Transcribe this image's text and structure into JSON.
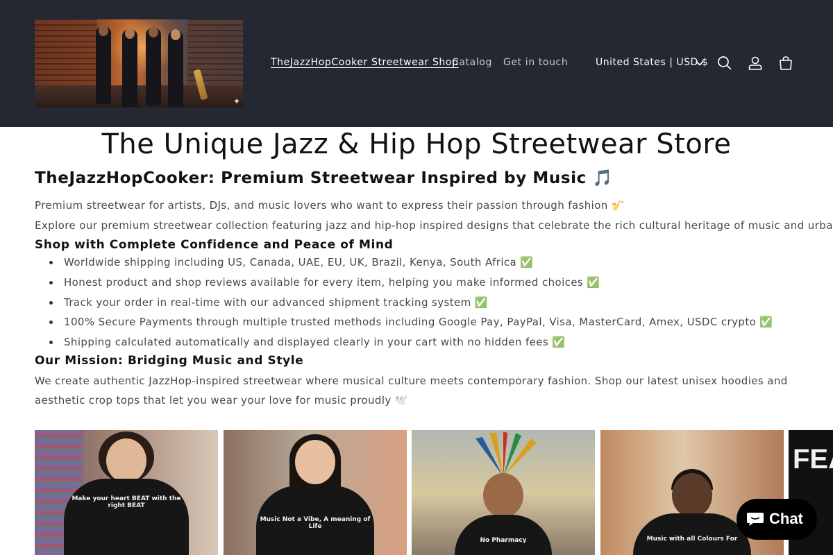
{
  "header": {
    "logo_alt": "TheJazzHopCooker logo",
    "nav": [
      {
        "label": "TheJazzHopCooker Streetwear Shop",
        "active": true
      },
      {
        "label": "Catalog",
        "active": false
      },
      {
        "label": "Get in touch",
        "active": false
      }
    ],
    "country_selector": "United States | USD $",
    "icons": [
      "search-icon",
      "account-icon",
      "cart-icon",
      "chevron-down-icon"
    ],
    "bg_color": "#242833"
  },
  "main": {
    "title": "The Unique Jazz & Hip Hop Streetwear Store",
    "subtitle": "TheJazzHopCooker: Premium Streetwear Inspired by Music 🎵",
    "intro_1": "Premium streetwear for artists, DJs, and music lovers who want to express their passion through fashion 🎷",
    "intro_2": "Explore our premium streetwear collection featuring jazz and hip-hop inspired designs that celebrate the rich cultural heritage of music and urban style.",
    "confidence_heading": "Shop with Complete Confidence and Peace of Mind",
    "confidence_items": [
      "Worldwide shipping including US, Canada, UAE, EU, UK, Brazil, Kenya, South Africa ✅",
      "Honest product and shop reviews available for every item, helping you make informed choices ✅",
      "Track your order in real-time with our advanced shipment tracking system ✅",
      "100% Secure Payments through multiple trusted methods including Google Pay, PayPal, Visa, MasterCard, Amex, USDC crypto ✅",
      "Shipping calculated automatically and displayed clearly in your cart with no hidden fees ✅"
    ],
    "mission_heading": "Our Mission: Bridging Music and Style",
    "mission_text": "We create authentic JazzHop-inspired streetwear where musical culture meets contemporary fashion. Shop our latest unisex hoodies and aesthetic crop tops that let you wear your love for music proudly 🕊️"
  },
  "products": {
    "cards": [
      {
        "print_text": "Make your heart BEAT with the right BEAT"
      },
      {
        "print_text": "Music Not a Vibe, A meaning of Life"
      },
      {
        "print_text": "No Pharmacy"
      },
      {
        "print_text": "Music with all Colours For"
      },
      {
        "print_text": "FEA HO"
      }
    ]
  },
  "chat": {
    "label": "Chat"
  }
}
